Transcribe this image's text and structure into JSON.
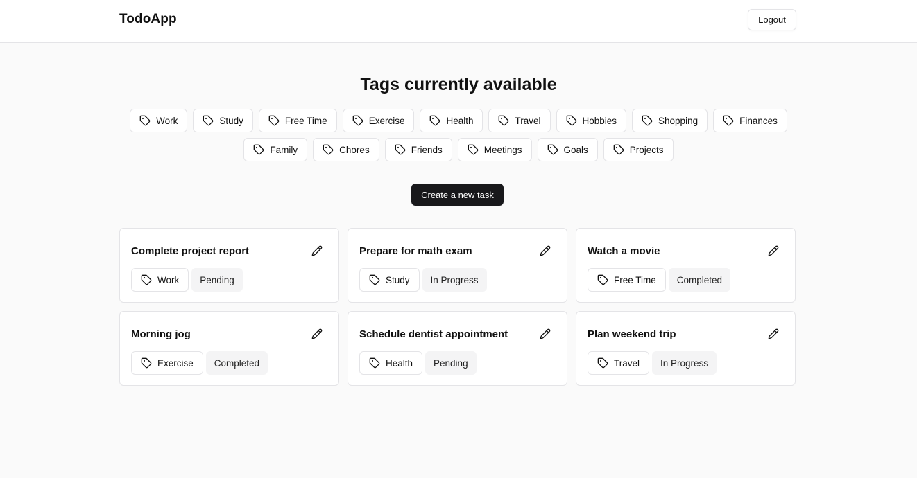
{
  "header": {
    "brand": "TodoApp",
    "logout_label": "Logout"
  },
  "tags_section": {
    "title": "Tags currently available",
    "row1": [
      "Work",
      "Study",
      "Free Time",
      "Exercise",
      "Health",
      "Travel",
      "Hobbies",
      "Shopping",
      "Finances"
    ],
    "row2": [
      "Family",
      "Chores",
      "Friends",
      "Meetings",
      "Goals",
      "Projects"
    ]
  },
  "create_label": "Create a new task",
  "tasks": [
    {
      "title": "Complete project report",
      "tag": "Work",
      "status": "Pending"
    },
    {
      "title": "Prepare for math exam",
      "tag": "Study",
      "status": "In Progress"
    },
    {
      "title": "Watch a movie",
      "tag": "Free Time",
      "status": "Completed"
    },
    {
      "title": "Morning jog",
      "tag": "Exercise",
      "status": "Completed"
    },
    {
      "title": "Schedule dentist appointment",
      "tag": "Health",
      "status": "Pending"
    },
    {
      "title": "Plan weekend trip",
      "tag": "Travel",
      "status": "In Progress"
    }
  ],
  "icons": {
    "tag": "tag-icon",
    "edit": "pencil-icon"
  },
  "colors": {
    "primary_button": "#18181b",
    "status_bg": "#f4f4f5",
    "border": "#e4e4e7"
  }
}
